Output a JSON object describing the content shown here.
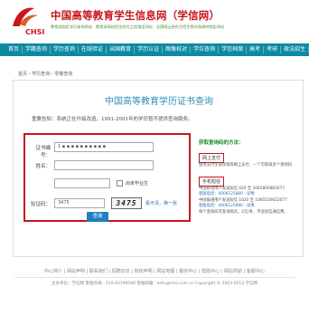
{
  "header": {
    "logo_text": "CHSI",
    "title": "中国高等教育学生信息网（学信网）",
    "subtitle": "教育部指定学历查询网站 · 教育部高校招生阳光工程指定网站 · 全国硕士研究生招生报名和调剂指定网站"
  },
  "nav": [
    "首页",
    "学籍查询",
    "学历查询",
    "在线验证",
    "出国教育",
    "学历认证",
    "图像校对",
    "学位查询",
    "学信档案",
    "高考",
    "考研",
    "政法招生",
    "港澳台招生",
    "四六级"
  ],
  "breadcrumb": "首页 › 学历查询 › 零散查询",
  "page": {
    "title": "中国高等教育学历证书查询",
    "notice": "重要告知：系统正在升级改造，1991-2001年的学历暂不提供查询服务。"
  },
  "form": {
    "cert_label": "证书编号：",
    "cert_value": "1 ▪ ▪ ▪ ▪ ▪ ▪ ▪ ▪ ▪ ▪",
    "name_label": "姓名：",
    "name_value": "",
    "grad_label": "尚未毕业生",
    "captcha_label": "验证码：",
    "captcha_value": "3475",
    "captcha_image_text": "3475",
    "refresh_link": "看不清，换一张",
    "query_button": "查询"
  },
  "help": {
    "title": "获取查询码的方法：",
    "method1": "网上支付",
    "method1_desc": "使用支付宝或快钱等网上支付，一个可获取多个查询码",
    "method2": "手机短信",
    "sms_lines": [
      "中国移动用户发送短信 020 至 1065800883077",
      "客服电话：4006125880 · 详情",
      "中国联通用户发送短信 1020 至 1065556622077",
      "客服电话：4006125880 · 详情"
    ],
    "note": "每个查询码可查询两次，2元/条，不含短信通信费。"
  },
  "footer": {
    "links": "中心简介 | 网站声明 | 联系我们 | 招聘信息 | 授权声明 | 网站地图 | 服务中心 | 帮助中心 | 网站导航 | 客服中心",
    "copyright": "主办单位：学信网   客服热线：010-82199588   客服邮箱：kefu@chsi.com.cn   Copyright © 2003-2013 学信网"
  },
  "colors": {
    "brand_red": "#c8161d",
    "nav_teal": "#0d8aa3",
    "title_blue": "#2f8fb5",
    "button_blue": "#1f7fc0",
    "help_green": "#1a8a2a"
  }
}
